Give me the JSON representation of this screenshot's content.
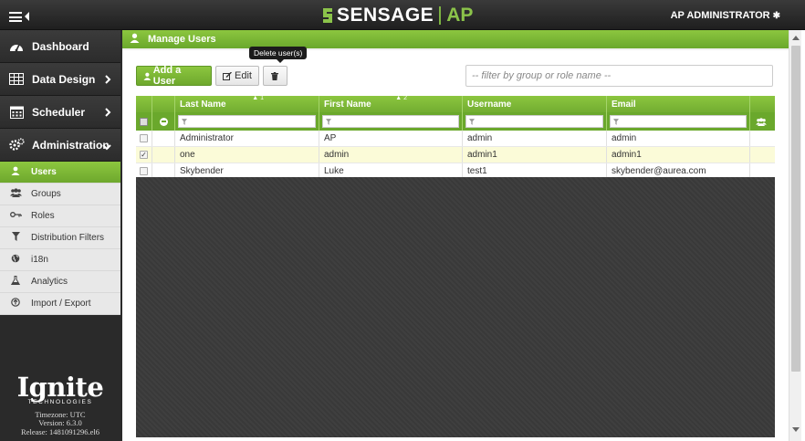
{
  "topbar": {
    "brand_name": "SENSAGE",
    "brand_product": "AP",
    "user_label": "AP ADMINISTRATOR",
    "icons": [
      "hamburger-icon",
      "collapse-left-icon",
      "gear-icon"
    ]
  },
  "sidebar": {
    "main_items": [
      {
        "label": "Dashboard",
        "icon": "dashboard-icon"
      },
      {
        "label": "Data Design",
        "icon": "table-icon"
      },
      {
        "label": "Scheduler",
        "icon": "calendar-icon"
      },
      {
        "label": "Administration",
        "icon": "gears-icon"
      }
    ],
    "sub_items": [
      {
        "label": "Users",
        "icon": "user-icon",
        "active": true
      },
      {
        "label": "Groups",
        "icon": "group-icon"
      },
      {
        "label": "Roles",
        "icon": "key-icon"
      },
      {
        "label": "Distribution Filters",
        "icon": "filter-icon"
      },
      {
        "label": "i18n",
        "icon": "globe-icon"
      },
      {
        "label": "Analytics",
        "icon": "flask-icon"
      },
      {
        "label": "Import / Export",
        "icon": "import-export-icon"
      }
    ],
    "footer": {
      "logo": "Ignite",
      "logo_sub": "TECHNOLOGIES",
      "timezone": "Timezone: UTC",
      "version": "Version: 6.3.0",
      "release": "Release: 1481091296.el6"
    }
  },
  "main": {
    "title": "Manage Users",
    "toolbar": {
      "add_label": "Add a User",
      "edit_label": "Edit",
      "delete_tooltip": "Delete user(s)"
    },
    "filter_placeholder": "-- filter by group or role name --",
    "grid": {
      "columns": [
        {
          "label": "Last Name",
          "sort": "1"
        },
        {
          "label": "First Name",
          "sort": "2"
        },
        {
          "label": "Username",
          "sort": ""
        },
        {
          "label": "Email",
          "sort": ""
        }
      ],
      "rows": [
        {
          "last": "Administrator",
          "first": "AP",
          "username": "admin",
          "email": "admin",
          "checked": false
        },
        {
          "last": "one",
          "first": "admin",
          "username": "admin1",
          "email": "admin1",
          "checked": true
        },
        {
          "last": "Skybender",
          "first": "Luke",
          "username": "test1",
          "email": "skybender@aurea.com",
          "checked": false
        }
      ]
    }
  },
  "colors": {
    "accent_green": "#8cc63f",
    "topbar_dark": "#2a2a2a",
    "selected_row": "#fbfbd8"
  }
}
